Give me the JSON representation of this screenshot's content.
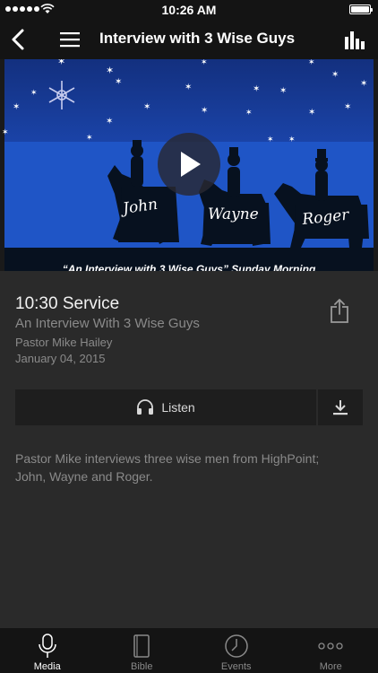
{
  "status_bar": {
    "time": "10:26 AM"
  },
  "nav": {
    "title": "Interview with 3 Wise Guys"
  },
  "hero": {
    "banner_text": "“An Interview with 3 Wise Guys”  Sunday Morning",
    "names": [
      "John",
      "Wayne",
      "Roger"
    ],
    "colors": {
      "sky_top": "#1a3f9f",
      "sky_bottom": "#1f52c6",
      "silhouette": "#07111f"
    }
  },
  "sermon": {
    "service_time": "10:30 Service",
    "title": "An Interview With 3 Wise Guys",
    "speaker": "Pastor Mike Hailey",
    "date": "January 04, 2015"
  },
  "actions": {
    "listen_label": "Listen"
  },
  "description": "Pastor Mike interviews three wise men from HighPoint; John, Wayne and Roger.",
  "tabs": [
    {
      "label": "Media",
      "icon": "microphone-icon",
      "active": true
    },
    {
      "label": "Bible",
      "icon": "book-icon",
      "active": false
    },
    {
      "label": "Events",
      "icon": "clock-icon",
      "active": false
    },
    {
      "label": "More",
      "icon": "more-icon",
      "active": false
    }
  ]
}
